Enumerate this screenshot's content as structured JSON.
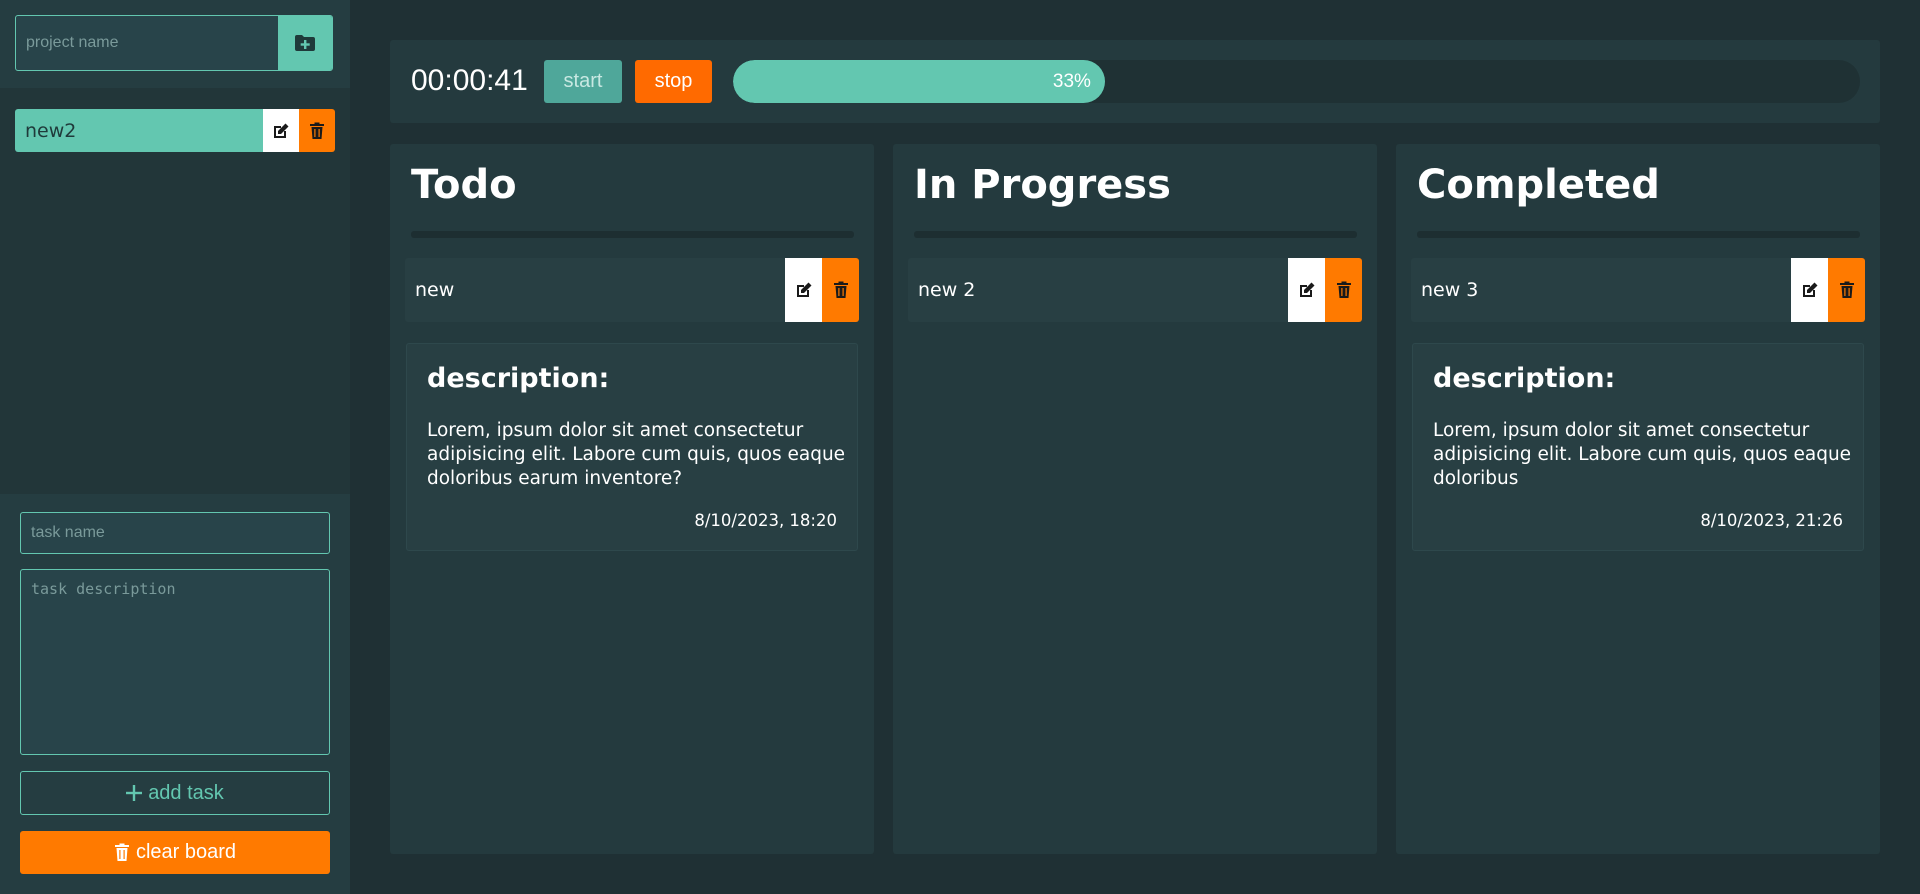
{
  "sidebar": {
    "project_input_placeholder": "project name",
    "add_project_icon": "folder-plus-icon",
    "projects": [
      {
        "name": "new2"
      }
    ],
    "task_name_placeholder": "task name",
    "task_description_placeholder": "task description",
    "add_task_label": "add task",
    "clear_board_label": "clear board"
  },
  "timer": {
    "time": "00:00:41",
    "start_label": "start",
    "stop_label": "stop",
    "progress_percent": 33,
    "progress_label": "33%"
  },
  "columns": [
    {
      "title": "Todo",
      "task": {
        "name": "new"
      },
      "description": {
        "heading": "description:",
        "text": "Lorem, ipsum dolor sit amet consectetur adipisicing elit. Labore cum quis, quos eaque doloribus earum inventore?",
        "date": "8/10/2023, 18:20"
      }
    },
    {
      "title": "In Progress",
      "task": {
        "name": "new 2"
      }
    },
    {
      "title": "Completed",
      "task": {
        "name": "new 3"
      },
      "description": {
        "heading": "description:",
        "text": "Lorem, ipsum dolor sit amet consectetur adipisicing elit. Labore cum quis, quos eaque doloribus",
        "date": "8/10/2023, 21:26"
      }
    }
  ],
  "colors": {
    "accent": "#63c7b0",
    "danger": "#ff7a00",
    "background": "#1f3034",
    "panel": "#243a3e"
  }
}
